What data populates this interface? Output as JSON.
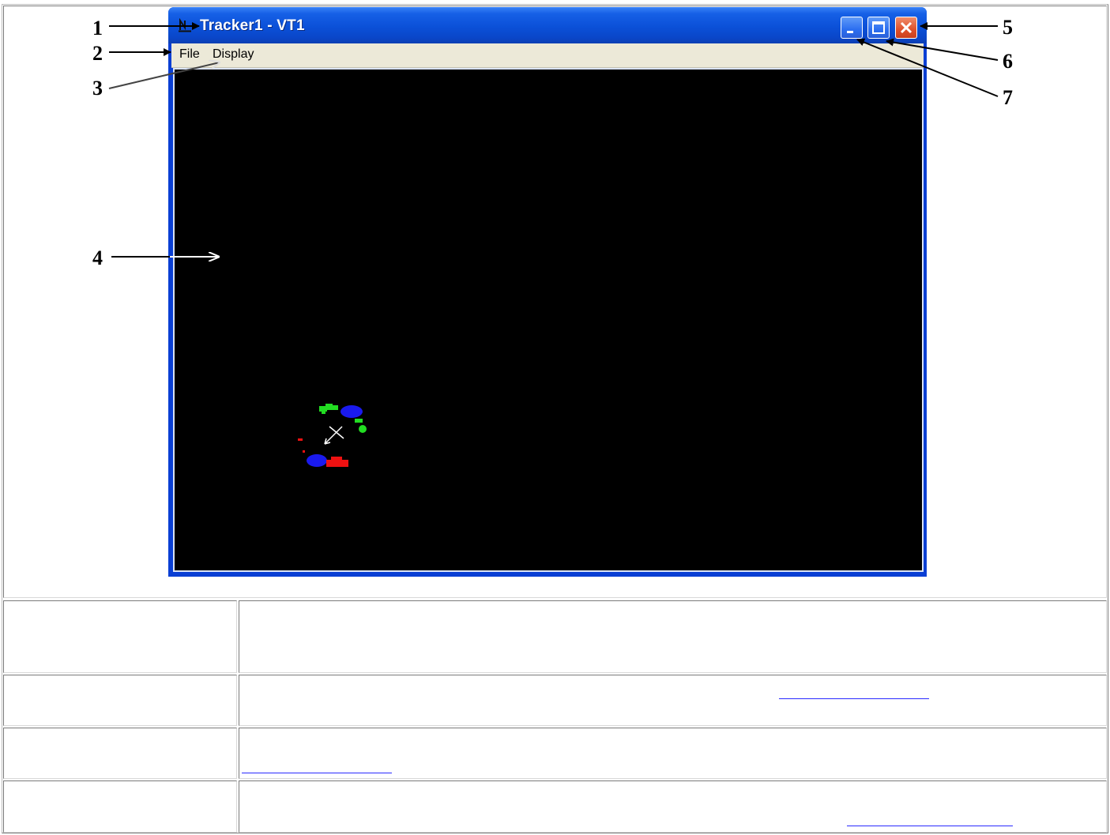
{
  "window": {
    "title": "Tracker1 - VT1",
    "controls": [
      "minimize",
      "maximize",
      "close"
    ]
  },
  "menu": {
    "items": [
      {
        "label": "File"
      },
      {
        "label": "Display"
      }
    ]
  },
  "callouts": [
    "1",
    "2",
    "3",
    "4",
    "5",
    "6",
    "7"
  ],
  "icons": {
    "window_icon": "tracker-app-icon",
    "minimize": "minimize-icon",
    "maximize": "maximize-icon",
    "close": "close-icon",
    "direction": "direction-arrow-icon"
  },
  "colors": {
    "titlebar": "#0b50d8",
    "menubar": "#ece9d8",
    "video_bg": "#000000",
    "close_button": "#e0502a",
    "target_green": "#22dd22",
    "target_blue": "#1a1aee",
    "target_red": "#ee1111"
  }
}
